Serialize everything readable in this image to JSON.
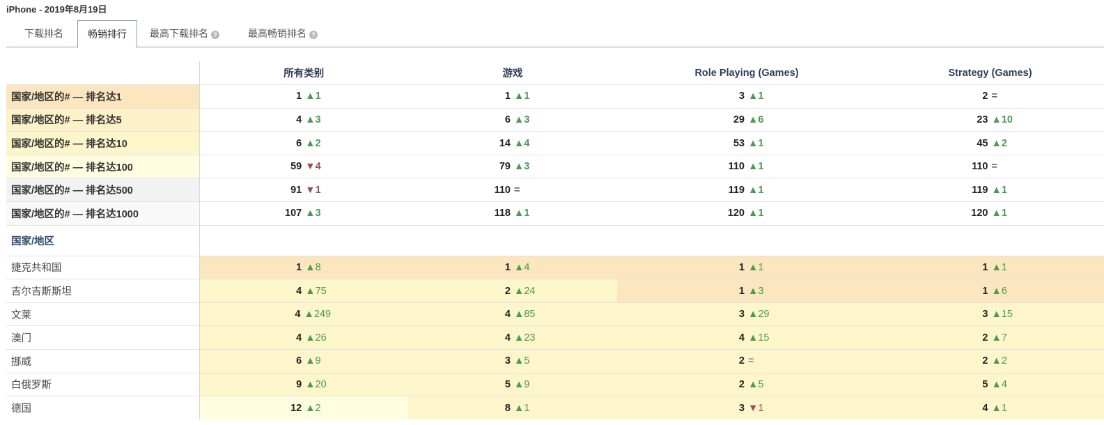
{
  "title": "iPhone - 2019年8月19日",
  "tabs": [
    {
      "label": "下载排名",
      "active": false,
      "help": false
    },
    {
      "label": "畅销排行",
      "active": true,
      "help": false
    },
    {
      "label": "最高下载排名",
      "active": false,
      "help": true
    },
    {
      "label": "最高畅销排名",
      "active": false,
      "help": true
    }
  ],
  "help_glyph": "?",
  "columns": [
    "所有类别",
    "游戏",
    "Role Playing (Games)",
    "Strategy (Games)"
  ],
  "summary_rows": [
    {
      "label": "国家/地区的# — 排名达1",
      "cells": [
        [
          "1",
          "▲1",
          "up"
        ],
        [
          "1",
          "▲1",
          "up"
        ],
        [
          "3",
          "▲1",
          "up"
        ],
        [
          "2",
          "=",
          "eq"
        ]
      ]
    },
    {
      "label": "国家/地区的# — 排名达5",
      "cells": [
        [
          "4",
          "▲3",
          "up"
        ],
        [
          "6",
          "▲3",
          "up"
        ],
        [
          "29",
          "▲6",
          "up"
        ],
        [
          "23",
          "▲10",
          "up"
        ]
      ]
    },
    {
      "label": "国家/地区的# — 排名达10",
      "cells": [
        [
          "6",
          "▲2",
          "up"
        ],
        [
          "14",
          "▲4",
          "up"
        ],
        [
          "53",
          "▲1",
          "up"
        ],
        [
          "45",
          "▲2",
          "up"
        ]
      ]
    },
    {
      "label": "国家/地区的# — 排名达100",
      "cells": [
        [
          "59",
          "▼4",
          "down"
        ],
        [
          "79",
          "▲3",
          "up"
        ],
        [
          "110",
          "▲1",
          "up"
        ],
        [
          "110",
          "=",
          "eq"
        ]
      ]
    },
    {
      "label": "国家/地区的# — 排名达500",
      "cells": [
        [
          "91",
          "▼1",
          "down"
        ],
        [
          "110",
          "=",
          "eq"
        ],
        [
          "119",
          "▲1",
          "up"
        ],
        [
          "119",
          "▲1",
          "up"
        ]
      ]
    },
    {
      "label": "国家/地区的# — 排名达1000",
      "cells": [
        [
          "107",
          "▲3",
          "up"
        ],
        [
          "118",
          "▲1",
          "up"
        ],
        [
          "120",
          "▲1",
          "up"
        ],
        [
          "120",
          "▲1",
          "up"
        ]
      ]
    }
  ],
  "section_label": "国家/地区",
  "country_rows": [
    {
      "label": "捷克共和国",
      "cells": [
        [
          "1",
          "▲8",
          "up"
        ],
        [
          "1",
          "▲4",
          "up"
        ],
        [
          "1",
          "▲1",
          "up"
        ],
        [
          "1",
          "▲1",
          "up"
        ]
      ]
    },
    {
      "label": "吉尔吉斯斯坦",
      "cells": [
        [
          "4",
          "▲75",
          "up"
        ],
        [
          "2",
          "▲24",
          "up"
        ],
        [
          "1",
          "▲3",
          "up"
        ],
        [
          "1",
          "▲6",
          "up"
        ]
      ]
    },
    {
      "label": "文莱",
      "cells": [
        [
          "4",
          "▲249",
          "up"
        ],
        [
          "4",
          "▲85",
          "up"
        ],
        [
          "3",
          "▲29",
          "up"
        ],
        [
          "3",
          "▲15",
          "up"
        ]
      ]
    },
    {
      "label": "澳门",
      "cells": [
        [
          "4",
          "▲26",
          "up"
        ],
        [
          "4",
          "▲23",
          "up"
        ],
        [
          "4",
          "▲15",
          "up"
        ],
        [
          "2",
          "▲7",
          "up"
        ]
      ]
    },
    {
      "label": "挪威",
      "cells": [
        [
          "6",
          "▲9",
          "up"
        ],
        [
          "3",
          "▲5",
          "up"
        ],
        [
          "2",
          "=",
          "eq"
        ],
        [
          "2",
          "▲2",
          "up"
        ]
      ]
    },
    {
      "label": "白俄罗斯",
      "cells": [
        [
          "9",
          "▲20",
          "up"
        ],
        [
          "5",
          "▲9",
          "up"
        ],
        [
          "2",
          "▲5",
          "up"
        ],
        [
          "5",
          "▲4",
          "up"
        ]
      ]
    },
    {
      "label": "德国",
      "cells": [
        [
          "12",
          "▲2",
          "up"
        ],
        [
          "8",
          "▲1",
          "up"
        ],
        [
          "3",
          "▼1",
          "down"
        ],
        [
          "4",
          "▲1",
          "up"
        ]
      ]
    }
  ],
  "colors": {
    "top1": "#fbe6bf",
    "top5": "#fdf1c8",
    "top10": "#fef6cb",
    "top100": "#fffde0",
    "up": "#4a9a55",
    "down": "#9a4d55",
    "tab_border": "#8aa0b2"
  }
}
